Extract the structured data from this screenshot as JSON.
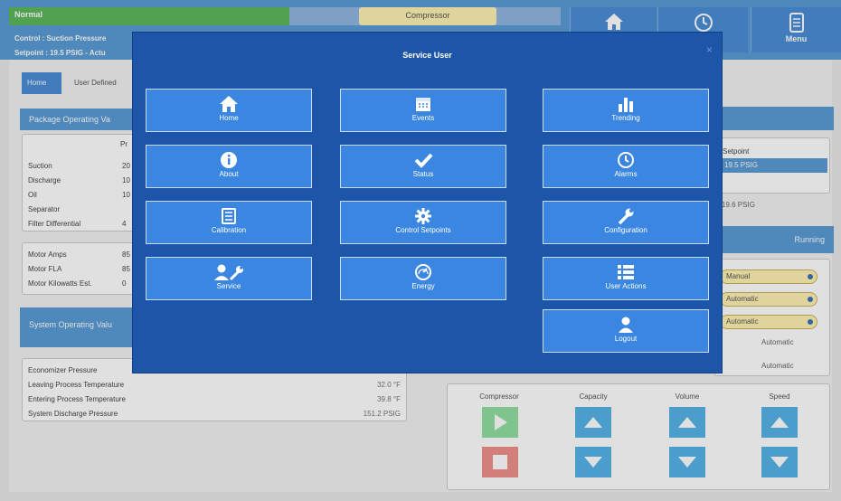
{
  "header": {
    "status": "Normal",
    "compressor_tab": "Compressor",
    "control_line": "Control : Suction Pressure",
    "setpoint_line": "Setpoint : 19.5 PSIG - Actu",
    "menu_label": "Menu"
  },
  "tabs": {
    "home": "Home",
    "user_defined": "User Defined"
  },
  "package": {
    "title": "Package Operating Va",
    "col_header": "Pr",
    "rows": [
      {
        "label": "Suction",
        "value": "20"
      },
      {
        "label": "Discharge",
        "value": "10"
      },
      {
        "label": "Oil",
        "value": "10"
      },
      {
        "label": "Separator",
        "value": ""
      },
      {
        "label": "Filter Differential",
        "value": "4"
      }
    ],
    "motor_rows": [
      {
        "label": "Motor Amps",
        "value": "85"
      },
      {
        "label": "Motor FLA",
        "value": "85"
      },
      {
        "label": "Motor Kilowatts Est.",
        "value": "0"
      }
    ]
  },
  "system": {
    "title": "System Operating Valu",
    "rows": [
      {
        "label": "Economizer Pressure",
        "value": ""
      },
      {
        "label": "Leaving Process Temperature",
        "value": "32.0 °F"
      },
      {
        "label": "Entering Process Temperature",
        "value": "39.8 °F"
      },
      {
        "label": "System Discharge Pressure",
        "value": "151.2 PSIG"
      }
    ]
  },
  "right": {
    "setpoint_label": "Setpoint",
    "setpoint_value": "19.5 PSIG",
    "setpoint_value2": "19.6 PSIG",
    "running": "Running",
    "modes": [
      "Manual",
      "Automatic",
      "Automatic"
    ],
    "auto_labels": [
      "Automatic",
      "Automatic"
    ]
  },
  "controls": {
    "compressor": "Compressor",
    "capacity": "Capacity",
    "volume": "Volume",
    "speed": "Speed"
  },
  "modal": {
    "title": "Service User",
    "buttons": {
      "home": "Home",
      "events": "Events",
      "trending": "Trending",
      "about": "About",
      "status": "Status",
      "alarms": "Alarms",
      "calibration": "Calibration",
      "control_setpoints": "Control Setpoints",
      "configuration": "Configuration",
      "service": "Service",
      "energy": "Energy",
      "user_actions": "User Actions",
      "logout": "Logout"
    }
  },
  "colors": {
    "primary": "#5b9bd5",
    "modal_bg": "#1d56a8",
    "button": "#3a86e0",
    "ok": "#5cb85c",
    "accent_yellow": "#fff2b3"
  }
}
